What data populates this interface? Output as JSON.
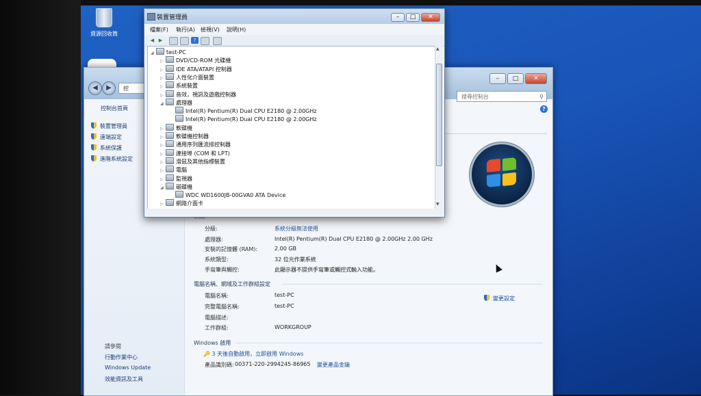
{
  "desktop": {
    "recycle_bin_label": "資源回收筒"
  },
  "system_window": {
    "address_text": "控",
    "search_placeholder": "搜尋控制台",
    "sidebar": {
      "home": "控制台首頁",
      "links": [
        "裝置管理員",
        "遠端設定",
        "系統保護",
        "進階系統設定"
      ],
      "see_also_title": "請參閱",
      "see_also": [
        "行動作業中心",
        "Windows Update",
        "效能資訊及工具"
      ]
    },
    "system_section": {
      "title": "系統",
      "rows": [
        {
          "label": "分級:",
          "value": "系統分級無法使用",
          "link": true
        },
        {
          "label": "處理器:",
          "value": "Intel(R) Pentium(R) Dual  CPU  E2180  @ 2.00GHz   2.00 GHz",
          "link": false
        },
        {
          "label": "安裝的記憶體 (RAM):",
          "value": "2.00 GB",
          "link": false
        },
        {
          "label": "系統類型:",
          "value": "32 位元作業系統",
          "link": false
        },
        {
          "label": "手寫筆與觸控:",
          "value": "此顯示器不提供手寫筆或觸控式輸入功能。",
          "link": false
        }
      ]
    },
    "computer_section": {
      "title": "電腦名稱、網域及工作群組設定",
      "change_settings": "變更設定",
      "rows": [
        {
          "label": "電腦名稱:",
          "value": "test-PC"
        },
        {
          "label": "完整電腦名稱:",
          "value": "test-PC"
        },
        {
          "label": "電腦描述:",
          "value": ""
        },
        {
          "label": "工作群組:",
          "value": "WORKGROUP"
        }
      ]
    },
    "activation_section": {
      "title": "Windows 啟用",
      "activation_link": "3 天後自動啟用，立即啟用 Windows",
      "product_id_label": "產品識別碼:",
      "product_id": "00371-220-2994245-86965",
      "change_key": "變更產品金鑰"
    }
  },
  "device_manager": {
    "title": "裝置管理員",
    "menu": [
      "檔案(F)",
      "執行(A)",
      "檢視(V)",
      "說明(H)"
    ],
    "tree": [
      {
        "label": "test-PC",
        "level": 0,
        "expanded": true,
        "icon": "computer-icon"
      },
      {
        "label": "DVD/CD-ROM 光碟機",
        "level": 1,
        "expanded": false,
        "icon": "dvd-icon"
      },
      {
        "label": "IDE ATA/ATAPI 控制器",
        "level": 1,
        "expanded": false,
        "icon": "ide-controller-icon"
      },
      {
        "label": "人性化介面裝置",
        "level": 1,
        "expanded": false,
        "icon": "hid-icon"
      },
      {
        "label": "系統裝置",
        "level": 1,
        "expanded": false,
        "icon": "system-device-icon"
      },
      {
        "label": "音效，視訊及遊戲控制器",
        "level": 1,
        "expanded": false,
        "icon": "sound-icon"
      },
      {
        "label": "處理器",
        "level": 1,
        "expanded": true,
        "icon": "processor-icon"
      },
      {
        "label": "Intel(R) Pentium(R) Dual  CPU  E2180  @ 2.00GHz",
        "level": 2,
        "expanded": null,
        "icon": "cpu-icon"
      },
      {
        "label": "Intel(R) Pentium(R) Dual  CPU  E2180  @ 2.00GHz",
        "level": 2,
        "expanded": null,
        "icon": "cpu-icon"
      },
      {
        "label": "軟碟機",
        "level": 1,
        "expanded": false,
        "icon": "floppy-icon"
      },
      {
        "label": "軟碟機控制器",
        "level": 1,
        "expanded": false,
        "icon": "floppy-controller-icon"
      },
      {
        "label": "通用序列匯流排控制器",
        "level": 1,
        "expanded": false,
        "icon": "usb-icon"
      },
      {
        "label": "連接埠 (COM 和 LPT)",
        "level": 1,
        "expanded": false,
        "icon": "port-icon"
      },
      {
        "label": "滑鼠及其他指標裝置",
        "level": 1,
        "expanded": false,
        "icon": "mouse-icon"
      },
      {
        "label": "電腦",
        "level": 1,
        "expanded": false,
        "icon": "pc-icon"
      },
      {
        "label": "監視器",
        "level": 1,
        "expanded": false,
        "icon": "monitor-icon"
      },
      {
        "label": "磁碟機",
        "level": 1,
        "expanded": true,
        "icon": "disk-icon"
      },
      {
        "label": "WDC WD1600JB-00GVA0 ATA Device",
        "level": 2,
        "expanded": null,
        "icon": "hdd-icon"
      },
      {
        "label": "網路介面卡",
        "level": 1,
        "expanded": false,
        "icon": "network-icon"
      }
    ]
  }
}
